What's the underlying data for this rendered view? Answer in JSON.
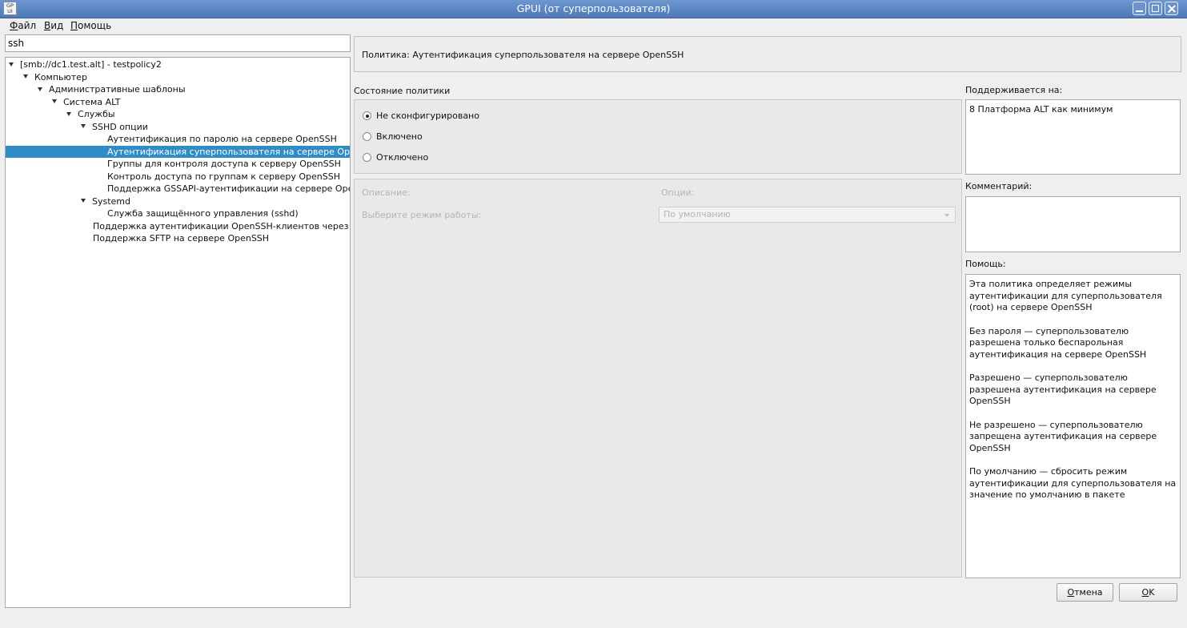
{
  "window": {
    "title": "GPUI (от суперпользователя)",
    "icon_text": "GP UI"
  },
  "menu": {
    "file": "Файл",
    "view": "Вид",
    "help": "Помощь"
  },
  "search": {
    "value": "ssh"
  },
  "tree": [
    {
      "label": "[smb://dc1.test.alt] - testpolicy2",
      "level": 0,
      "expanded": true
    },
    {
      "label": "Компьютер",
      "level": 1,
      "expanded": true
    },
    {
      "label": "Административные шаблоны",
      "level": 2,
      "expanded": true
    },
    {
      "label": "Система ALT",
      "level": 3,
      "expanded": true
    },
    {
      "label": "Службы",
      "level": 4,
      "expanded": true
    },
    {
      "label": "SSHD опции",
      "level": 5,
      "expanded": true
    },
    {
      "label": "Аутентификация по паролю на сервере OpenSSH",
      "level": 6
    },
    {
      "label": "Аутентификация суперпользователя на сервере Ope...",
      "level": 6,
      "selected": true
    },
    {
      "label": "Группы для контроля доступа к серверу OpenSSH",
      "level": 6
    },
    {
      "label": "Контроль доступа по группам к серверу OpenSSH",
      "level": 6
    },
    {
      "label": "Поддержка GSSAPI-аутентификации на сервере Ope...",
      "level": 6
    },
    {
      "label": "Systemd",
      "level": 5,
      "expanded": true
    },
    {
      "label": "Служба защищённого управления (sshd)",
      "level": 6
    },
    {
      "label": "Поддержка аутентификации OpenSSH-клиентов через G...",
      "level": 5
    },
    {
      "label": "Поддержка SFTP на сервере OpenSSH",
      "level": 5
    }
  ],
  "policy": {
    "header": "Политика: Аутентификация суперпользователя на сервере OpenSSH",
    "state_label": "Состояние политики",
    "state_options": [
      "Не сконфигурировано",
      "Включено",
      "Отключено"
    ],
    "selected_state": 0,
    "description_label": "Описание:",
    "options_label": "Опции:",
    "mode_label": "Выберите режим работы:",
    "mode_value": "По умолчанию",
    "supported_label": "Поддерживается на:",
    "supported_value": "8 Платформа ALT как минимум",
    "comment_label": "Комментарий:",
    "comment_value": "",
    "help_label": "Помощь:",
    "help_paragraphs": [
      "Эта политика определяет режимы аутентификации для суперпользователя (root) на сервере OpenSSH",
      "Без пароля — суперпользователю разрешена только беспарольная аутентификация на сервере OpenSSH",
      "Разрешено — суперпользователю разрешена аутентификация на сервере OpenSSH",
      "Не разрешено — суперпользователю запрещена аутентификация на сервере OpenSSH",
      "По умолчанию — сбросить режим аутентификации для суперпользователя на значение по умолчанию в пакете"
    ]
  },
  "buttons": {
    "cancel": "Отмена",
    "ok": "OK"
  }
}
